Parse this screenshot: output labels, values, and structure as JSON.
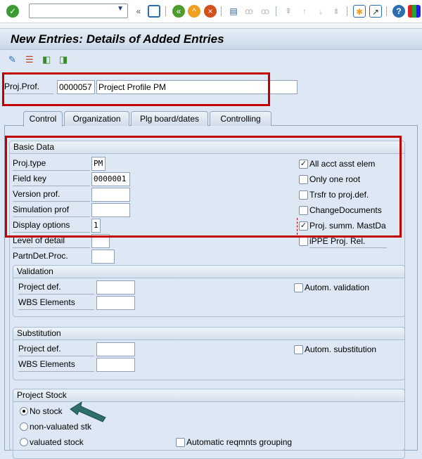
{
  "toolbar": {
    "command_field": "",
    "icons": [
      "enter-icon",
      "back-double-icon",
      "save-icon",
      "back-icon",
      "exit-icon",
      "cancel-icon",
      "print-icon",
      "find-icon",
      "find-next-icon",
      "first-page-icon",
      "prev-page-icon",
      "next-page-icon",
      "last-page-icon",
      "new-session-icon",
      "shortcut-icon",
      "help-icon",
      "layout-icon"
    ]
  },
  "title": "New Entries: Details of Added Entries",
  "app_toolbar": {
    "icons": [
      "display-change-icon",
      "delete-icon",
      "previous-entry-icon",
      "next-entry-icon"
    ]
  },
  "header": {
    "label": "Proj.Prof.",
    "code": "0000057",
    "description": "Project Profile PM"
  },
  "tabs": [
    {
      "label": "Control",
      "active": true
    },
    {
      "label": "Organization"
    },
    {
      "label": "Plg board/dates"
    },
    {
      "label": "Controlling"
    }
  ],
  "basic_data": {
    "title": "Basic Data",
    "fields": [
      {
        "label": "Proj.type",
        "value": "PM"
      },
      {
        "label": "Field key",
        "value": "0000001"
      },
      {
        "label": "Version prof.",
        "value": ""
      },
      {
        "label": "Simulation prof",
        "value": ""
      },
      {
        "label": "Display options",
        "value": "1"
      },
      {
        "label": "Level of detail",
        "value": ""
      },
      {
        "label": "PartnDet.Proc.",
        "value": ""
      }
    ],
    "checkboxes": [
      {
        "label": "All acct asst elem",
        "checked": true
      },
      {
        "label": "Only one root",
        "checked": false
      },
      {
        "label": "Trsfr to proj.def.",
        "checked": false
      },
      {
        "label": "ChangeDocuments",
        "checked": false
      },
      {
        "label": "Proj. summ. MastDa",
        "checked": true
      },
      {
        "label": "iPPE Proj. Rel.",
        "checked": false
      }
    ]
  },
  "validation": {
    "title": "Validation",
    "project_def": "Project def.",
    "wbs": "WBS Elements",
    "auto": "Autom. validation"
  },
  "substitution": {
    "title": "Substitution",
    "project_def": "Project def.",
    "wbs": "WBS Elements",
    "auto": "Autom. substitution"
  },
  "project_stock": {
    "title": "Project Stock",
    "options": [
      {
        "label": "No stock",
        "selected": true
      },
      {
        "label": "non-valuated stk"
      },
      {
        "label": "valuated stock"
      }
    ],
    "auto_grouping": "Automatic reqmnts grouping"
  },
  "colors": {
    "highlight": "#c00000",
    "arrow": "#2e6f6a"
  }
}
